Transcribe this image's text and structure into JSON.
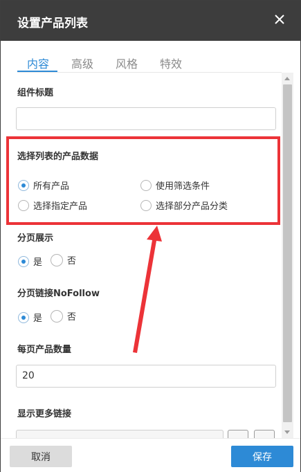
{
  "dialog": {
    "title": "设置产品列表",
    "close_icon": "close-icon"
  },
  "tabs": [
    {
      "label": "内容",
      "active": true
    },
    {
      "label": "高级",
      "active": false
    },
    {
      "label": "风格",
      "active": false
    },
    {
      "label": "特效",
      "active": false
    }
  ],
  "fields": {
    "component_title": {
      "label": "组件标题",
      "value": ""
    },
    "product_data": {
      "label": "选择列表的产品数据",
      "options": [
        {
          "label": "所有产品",
          "checked": true
        },
        {
          "label": "使用筛选条件",
          "checked": false
        },
        {
          "label": "选择指定产品",
          "checked": false
        },
        {
          "label": "选择部分产品分类",
          "checked": false
        }
      ]
    },
    "pagination": {
      "label": "分页展示",
      "options": [
        {
          "label": "是",
          "checked": true
        },
        {
          "label": "否",
          "checked": false
        }
      ]
    },
    "pagination_nofollow": {
      "label": "分页链接NoFollow",
      "options": [
        {
          "label": "是",
          "checked": true
        },
        {
          "label": "否",
          "checked": false
        }
      ]
    },
    "per_page": {
      "label": "每页产品数量",
      "value": "20"
    },
    "more_link": {
      "label": "显示更多链接"
    }
  },
  "footer": {
    "cancel_label": "取消",
    "save_label": "保存"
  },
  "colors": {
    "header_bg": "#3d3d3d",
    "accent": "#2d8ad6",
    "annotation_red": "#ec3338"
  }
}
